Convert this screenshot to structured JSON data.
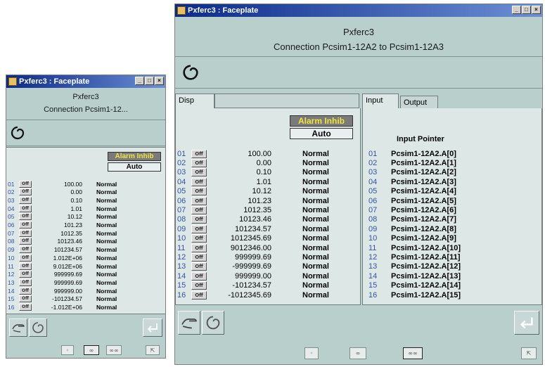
{
  "windows": [
    {
      "id": "small",
      "title": "Pxferc3 : Faceplate",
      "header_line1": "Pxferc3",
      "header_line2": "Connection Pcsim1-12...",
      "disp_tab": "",
      "alarm_inhibit": "Alarm Inhib",
      "mode": "Auto",
      "rows": [
        {
          "num": "01",
          "btn": "Off",
          "value": "100.00",
          "status": "Normal"
        },
        {
          "num": "02",
          "btn": "Off",
          "value": "0.00",
          "status": "Normal"
        },
        {
          "num": "03",
          "btn": "Off",
          "value": "0.10",
          "status": "Normal"
        },
        {
          "num": "04",
          "btn": "Off",
          "value": "1.01",
          "status": "Normal"
        },
        {
          "num": "05",
          "btn": "Off",
          "value": "10.12",
          "status": "Normal"
        },
        {
          "num": "06",
          "btn": "Off",
          "value": "101.23",
          "status": "Normal"
        },
        {
          "num": "07",
          "btn": "Off",
          "value": "1012.35",
          "status": "Normal"
        },
        {
          "num": "08",
          "btn": "Off",
          "value": "10123.46",
          "status": "Normal"
        },
        {
          "num": "09",
          "btn": "Off",
          "value": "101234.57",
          "status": "Normal"
        },
        {
          "num": "10",
          "btn": "Off",
          "value": "1.012E+06",
          "status": "Normal"
        },
        {
          "num": "11",
          "btn": "Off",
          "value": "9.012E+06",
          "status": "Normal"
        },
        {
          "num": "12",
          "btn": "Off",
          "value": "999999.69",
          "status": "Normal"
        },
        {
          "num": "13",
          "btn": "Off",
          "value": "999999.69",
          "status": "Normal"
        },
        {
          "num": "14",
          "btn": "Off",
          "value": "999999.00",
          "status": "Normal"
        },
        {
          "num": "15",
          "btn": "Off",
          "value": "-101234.57",
          "status": "Normal"
        },
        {
          "num": "16",
          "btn": "Off",
          "value": "-1.012E+06",
          "status": "Normal"
        }
      ]
    },
    {
      "id": "large",
      "title": "Pxferc3 : Faceplate",
      "header_line1": "Pxferc3",
      "header_line2": "Connection Pcsim1-12A2 to Pcsim1-12A3",
      "disp_tab": "Disp",
      "input_tab": "Input",
      "output_tab": "Output",
      "alarm_inhibit": "Alarm Inhib",
      "mode": "Auto",
      "input_header": "Input Pointer",
      "rows": [
        {
          "num": "01",
          "btn": "Off",
          "value": "100.00",
          "status": "Normal",
          "pointer": "Pcsim1-12A2.A[0]"
        },
        {
          "num": "02",
          "btn": "Off",
          "value": "0.00",
          "status": "Normal",
          "pointer": "Pcsim1-12A2.A[1]"
        },
        {
          "num": "03",
          "btn": "Off",
          "value": "0.10",
          "status": "Normal",
          "pointer": "Pcsim1-12A2.A[2]"
        },
        {
          "num": "04",
          "btn": "Off",
          "value": "1.01",
          "status": "Normal",
          "pointer": "Pcsim1-12A2.A[3]"
        },
        {
          "num": "05",
          "btn": "Off",
          "value": "10.12",
          "status": "Normal",
          "pointer": "Pcsim1-12A2.A[4]"
        },
        {
          "num": "06",
          "btn": "Off",
          "value": "101.23",
          "status": "Normal",
          "pointer": "Pcsim1-12A2.A[5]"
        },
        {
          "num": "07",
          "btn": "Off",
          "value": "1012.35",
          "status": "Normal",
          "pointer": "Pcsim1-12A2.A[6]"
        },
        {
          "num": "08",
          "btn": "Off",
          "value": "10123.46",
          "status": "Normal",
          "pointer": "Pcsim1-12A2.A[7]"
        },
        {
          "num": "09",
          "btn": "Off",
          "value": "101234.57",
          "status": "Normal",
          "pointer": "Pcsim1-12A2.A[8]"
        },
        {
          "num": "10",
          "btn": "Off",
          "value": "1012345.69",
          "status": "Normal",
          "pointer": "Pcsim1-12A2.A[9]"
        },
        {
          "num": "11",
          "btn": "Off",
          "value": "9012346.00",
          "status": "Normal",
          "pointer": "Pcsim1-12A2.A[10]"
        },
        {
          "num": "12",
          "btn": "Off",
          "value": "999999.69",
          "status": "Normal",
          "pointer": "Pcsim1-12A2.A[11]"
        },
        {
          "num": "13",
          "btn": "Off",
          "value": "-999999.69",
          "status": "Normal",
          "pointer": "Pcsim1-12A2.A[12]"
        },
        {
          "num": "14",
          "btn": "Off",
          "value": "999999.00",
          "status": "Normal",
          "pointer": "Pcsim1-12A2.A[13]"
        },
        {
          "num": "15",
          "btn": "Off",
          "value": "-101234.57",
          "status": "Normal",
          "pointer": "Pcsim1-12A2.A[14]"
        },
        {
          "num": "16",
          "btn": "Off",
          "value": "-101234​5.69",
          "status": "Normal",
          "pointer": "Pcsim1-12A2.A[15]"
        }
      ]
    }
  ],
  "window_buttons": {
    "minimize": "_",
    "maximize": "□",
    "close": "×"
  },
  "nav_buttons": {
    "prev": "◦",
    "pair": "∞",
    "triple": "∞∞",
    "pin": "⇱"
  },
  "icons": [
    "swirl-logo-icon",
    "hand-icon",
    "spiral-icon",
    "enter-icon"
  ]
}
